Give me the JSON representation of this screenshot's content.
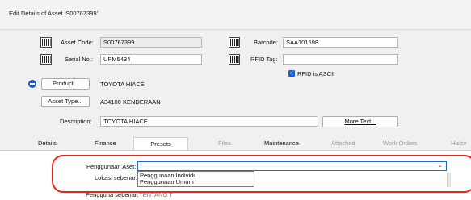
{
  "window": {
    "title": "Edit Details of Asset 'S00767399'"
  },
  "form": {
    "asset_code_label": "Asset Code:",
    "asset_code_value": "S00767399",
    "barcode_label": "Barcode:",
    "barcode_value": "SAA101598",
    "serial_no_label": "Serial No.:",
    "serial_no_value": "UPM5434",
    "rfid_tag_label": "RFID Tag:",
    "rfid_tag_value": "",
    "rfid_ascii_label": "RFID is ASCII",
    "rfid_ascii_checked": "✓",
    "product_button": "Product...",
    "product_value": "TOYOTA HIACE",
    "asset_type_button": "Asset Type...",
    "asset_type_value": "A34100 KENDERAAN",
    "description_label": "Description:",
    "description_value": "TOYOTA HIACE",
    "more_text_button": "More Text..."
  },
  "tabs": [
    {
      "label": "Details"
    },
    {
      "label": "Finance"
    },
    {
      "label": "Presets"
    },
    {
      "label": "Files"
    },
    {
      "label": "Maintenance"
    },
    {
      "label": "Attached"
    },
    {
      "label": "Work Orders"
    },
    {
      "label": "Histor"
    }
  ],
  "presets": {
    "penggunaan_aset_label": "Penggunaan Aset:",
    "penggunaan_aset_value": "",
    "lokasi_sebenar_label": "Lokasi sebenar:",
    "pengguna_sebenar_label": "Pengguna sebenar:",
    "pengguna_sebenar_value": "TENTANG T",
    "dropdown_options": [
      "Penggunaan Individu",
      "Penggunaan Umum"
    ]
  },
  "colors": {
    "accent": "#2b63c9",
    "highlight_border": "#e0281d",
    "checkbox": "#1a62d6"
  }
}
